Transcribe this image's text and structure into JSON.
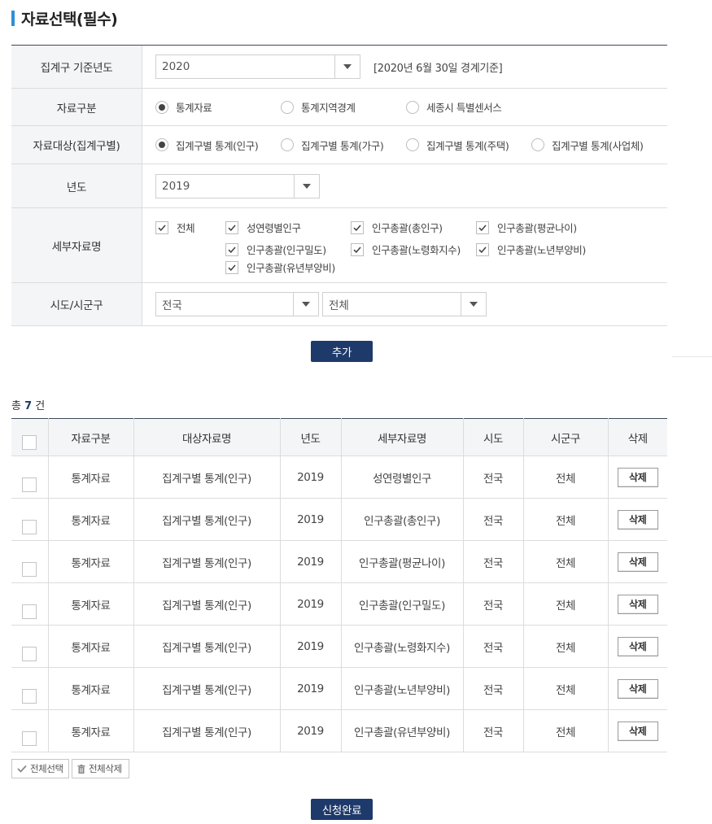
{
  "title": "자료선택(필수)",
  "form": {
    "base_year": {
      "label": "집계구 기준년도",
      "value": "2020",
      "note": "[2020년 6월 30일 경계기준]"
    },
    "data_type": {
      "label": "자료구분",
      "options": [
        "통계자료",
        "통계지역경계",
        "세종시 특별센서스"
      ],
      "selected": "통계자료"
    },
    "data_target": {
      "label": "자료대상(집계구별)",
      "options": [
        "집계구별 통계(인구)",
        "집계구별 통계(가구)",
        "집계구별 통계(주택)",
        "집계구별 통계(사업체)"
      ],
      "selected": "집계구별 통계(인구)"
    },
    "year": {
      "label": "년도",
      "value": "2019"
    },
    "detail": {
      "label": "세부자료명",
      "items": [
        "전체",
        "성연령별인구",
        "인구총괄(총인구)",
        "인구총괄(평균나이)",
        "인구총괄(인구밀도)",
        "인구총괄(노령화지수)",
        "인구총괄(노년부양비)",
        "인구총괄(유년부양비)"
      ]
    },
    "region": {
      "label": "시도/시군구",
      "sido": "전국",
      "sigungu": "전체"
    }
  },
  "add_button": "추가",
  "total": {
    "prefix": "총",
    "count": "7",
    "suffix": "건"
  },
  "table": {
    "headers": [
      "자료구분",
      "대상자료명",
      "년도",
      "세부자료명",
      "시도",
      "시군구",
      "삭제"
    ],
    "delete_label": "삭제",
    "rows": [
      [
        "통계자료",
        "집계구별 통계(인구)",
        "2019",
        "성연령별인구",
        "전국",
        "전체"
      ],
      [
        "통계자료",
        "집계구별 통계(인구)",
        "2019",
        "인구총괄(총인구)",
        "전국",
        "전체"
      ],
      [
        "통계자료",
        "집계구별 통계(인구)",
        "2019",
        "인구총괄(평균나이)",
        "전국",
        "전체"
      ],
      [
        "통계자료",
        "집계구별 통계(인구)",
        "2019",
        "인구총괄(인구밀도)",
        "전국",
        "전체"
      ],
      [
        "통계자료",
        "집계구별 통계(인구)",
        "2019",
        "인구총괄(노령화지수)",
        "전국",
        "전체"
      ],
      [
        "통계자료",
        "집계구별 통계(인구)",
        "2019",
        "인구총괄(노년부양비)",
        "전국",
        "전체"
      ],
      [
        "통계자료",
        "집계구별 통계(인구)",
        "2019",
        "인구총괄(유년부양비)",
        "전국",
        "전체"
      ]
    ]
  },
  "select_all_button": "전체선택",
  "delete_all_button": "전체삭제",
  "submit_button": "신청완료",
  "icons": {
    "check": "check-icon",
    "trash": "trash-icon",
    "dropdown": "chevron-down-icon"
  },
  "colors": {
    "accent": "#2f8fd8",
    "navy": "#1e3a6b"
  }
}
